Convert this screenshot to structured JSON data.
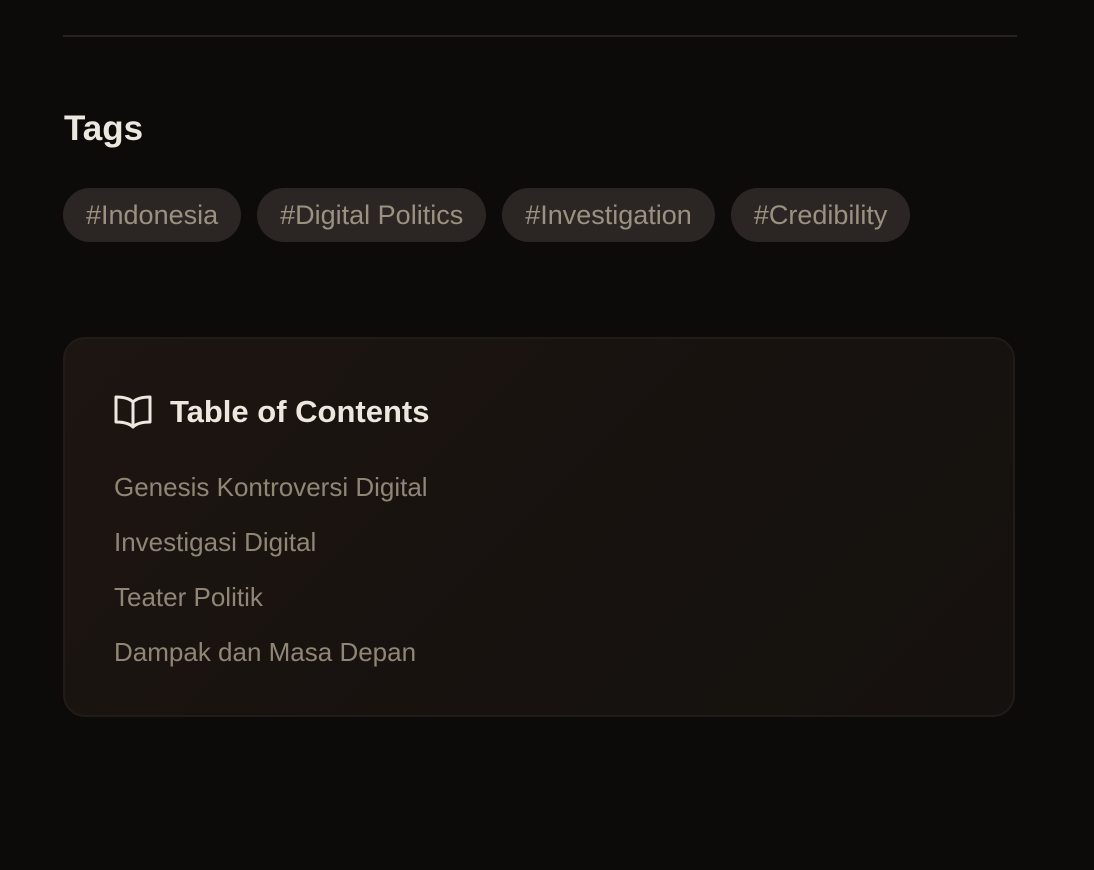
{
  "tags": {
    "heading": "Tags",
    "items": [
      "#Indonesia",
      "#Digital Politics",
      "#Investigation",
      "#Credibility"
    ]
  },
  "toc": {
    "icon": "book-open-icon",
    "title": "Table of Contents",
    "items": [
      "Genesis Kontroversi Digital",
      "Investigasi Digital",
      "Teater Politik",
      "Dampak dan Masa Depan"
    ]
  },
  "colors": {
    "background": "#0c0b0a",
    "tag_background": "#2b2624",
    "tag_text": "#9b9181",
    "heading_text": "#ece7df",
    "toc_item_text": "#8f8676"
  }
}
